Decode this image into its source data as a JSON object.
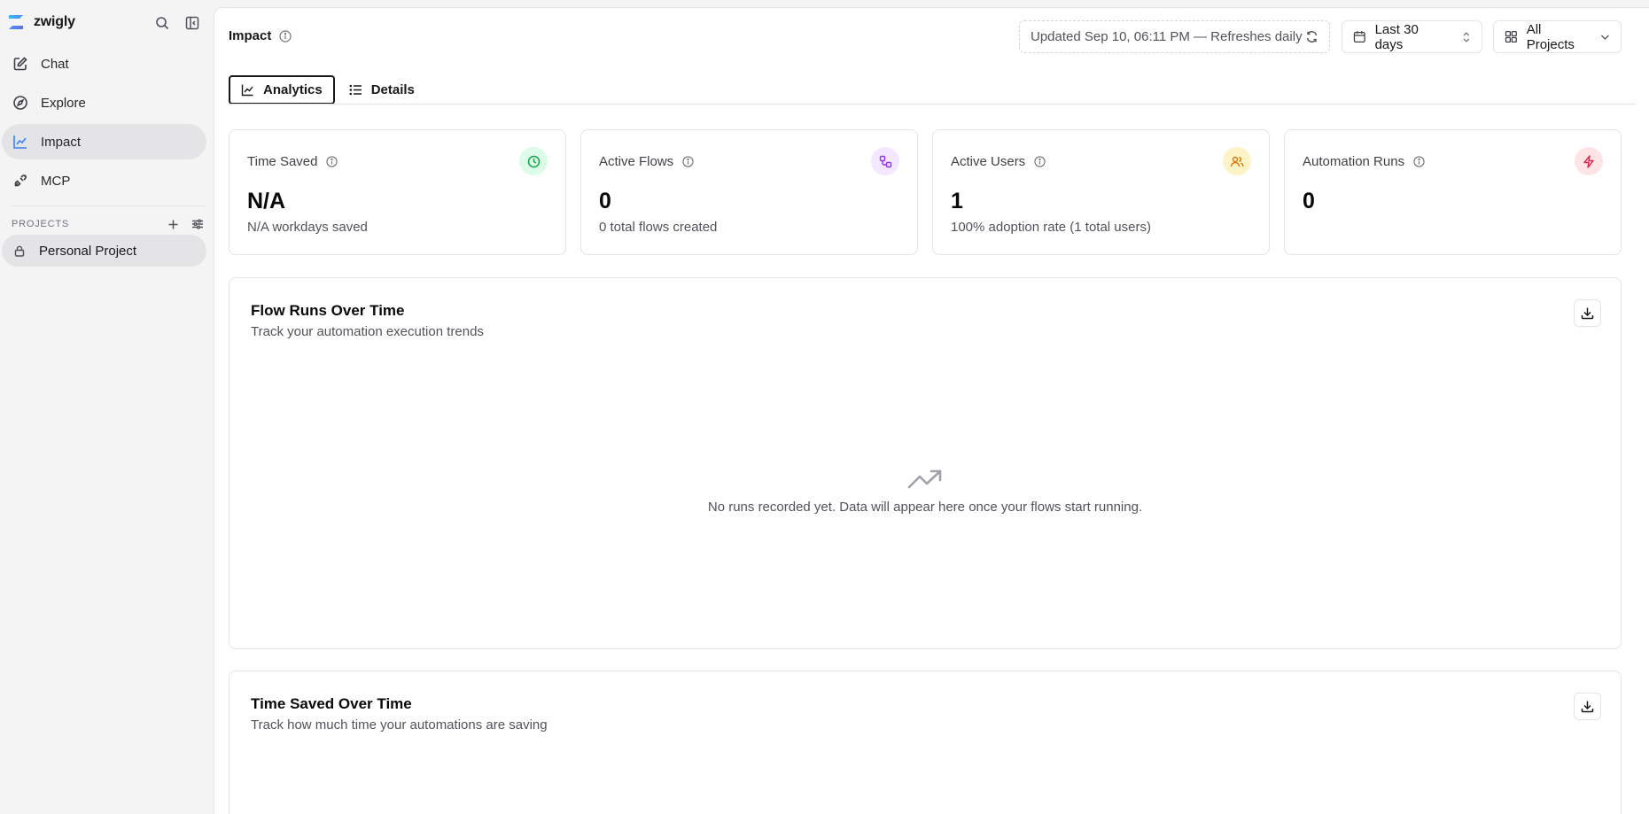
{
  "app": {
    "name": "zwigly"
  },
  "sidebar": {
    "items": [
      {
        "label": "Chat",
        "icon": "edit-icon"
      },
      {
        "label": "Explore",
        "icon": "compass-icon"
      },
      {
        "label": "Impact",
        "icon": "chart-line-icon",
        "active": true
      },
      {
        "label": "MCP",
        "icon": "plug-icon"
      }
    ],
    "projects_label": "PROJECTS",
    "projects": [
      {
        "label": "Personal Project",
        "icon": "lock-icon"
      }
    ]
  },
  "header": {
    "title": "Impact",
    "updated_text": "Updated Sep 10, 06:11 PM — Refreshes daily",
    "date_range": "Last 30 days",
    "project_filter": "All Projects"
  },
  "tabs": [
    {
      "label": "Analytics",
      "active": true
    },
    {
      "label": "Details",
      "active": false
    }
  ],
  "stats": [
    {
      "label": "Time Saved",
      "value": "N/A",
      "sub": "N/A workdays saved",
      "icon": "clock-icon",
      "color": "#16a34a",
      "bg": "#dcfce7"
    },
    {
      "label": "Active Flows",
      "value": "0",
      "sub": "0 total flows created",
      "icon": "workflow-icon",
      "color": "#9333ea",
      "bg": "#f3e8ff"
    },
    {
      "label": "Active Users",
      "value": "1",
      "sub": "100% adoption rate (1 total users)",
      "icon": "users-icon",
      "color": "#d97706",
      "bg": "#fef3c7"
    },
    {
      "label": "Automation Runs",
      "value": "0",
      "sub": "",
      "icon": "zap-icon",
      "color": "#e11d48",
      "bg": "#ffe4e6"
    }
  ],
  "panels": [
    {
      "title": "Flow Runs Over Time",
      "subtitle": "Track your automation execution trends",
      "empty_text": "No runs recorded yet. Data will appear here once your flows start running."
    },
    {
      "title": "Time Saved Over Time",
      "subtitle": "Track how much time your automations are saving"
    }
  ]
}
